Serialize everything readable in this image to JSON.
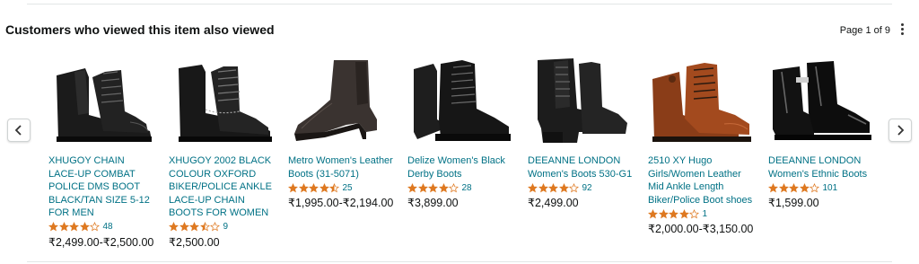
{
  "header": {
    "title": "Customers who viewed this item also viewed",
    "pager": "Page 1 of 9"
  },
  "colors": {
    "link": "#007185",
    "star": "#de7921",
    "text": "#0f1111"
  },
  "products": [
    {
      "title": "XHUGOY CHAIN LACE-UP COMBAT POLICE DMS BOOT BLACK/TAN SIZE 5-12 FOR MEN",
      "rating": 4.0,
      "rating_count": "48",
      "price": "₹2,499.00-₹2,500.00",
      "image": "black-combat-boot-icon"
    },
    {
      "title": "XHUGOY 2002 BLACK COLOUR OXFORD BIKER/POLICE ANKLE LACE-UP CHAIN BOOTS FOR WOMEN",
      "rating": 3.5,
      "rating_count": "9",
      "price": "₹2,500.00",
      "image": "black-oxford-boot-icon"
    },
    {
      "title": "Metro Women's Leather Boots (31-5071)",
      "rating": 4.5,
      "rating_count": "25",
      "price": "₹1,995.00-₹2,194.00",
      "image": "brown-heeled-boot-icon"
    },
    {
      "title": "Delize Women's Black Derby Boots",
      "rating": 4.0,
      "rating_count": "28",
      "price": "₹3,899.00",
      "image": "black-derby-boot-icon"
    },
    {
      "title": "DEEANNE LONDON Women's Boots 530-G1",
      "rating": 4.0,
      "rating_count": "92",
      "price": "₹2,499.00",
      "image": "black-block-heel-boot-icon"
    },
    {
      "title": "2510 XY Hugo Girls/Women Leather Mid Ankle Length Biker/Police Boot shoes",
      "rating": 4.0,
      "rating_count": "1",
      "price": "₹2,000.00-₹3,150.00",
      "image": "tan-biker-boot-icon"
    },
    {
      "title": "DEEANNE LONDON Women's Ethnic Boots",
      "rating": 4.0,
      "rating_count": "101",
      "price": "₹1,599.00",
      "image": "patent-ankle-boot-icon"
    }
  ]
}
